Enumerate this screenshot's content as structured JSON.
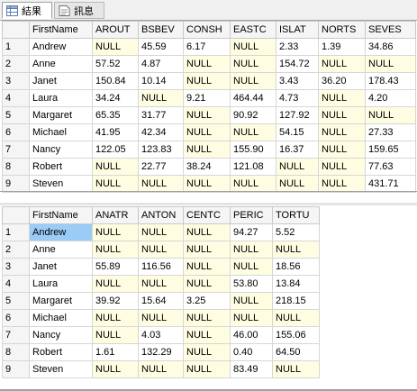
{
  "tabs": [
    {
      "label": "結果",
      "icon": "grid-icon"
    },
    {
      "label": "訊息",
      "icon": "message-icon"
    }
  ],
  "colors": {
    "null_cell": "#fffde1",
    "selected_cell": "#9bcbf7",
    "header": "#f5f5f5"
  },
  "grid1": {
    "columns": [
      "",
      "FirstName",
      "AROUT",
      "BSBEV",
      "CONSH",
      "EASTC",
      "ISLAT",
      "NORTS",
      "SEVES"
    ],
    "rows": [
      [
        "1",
        "Andrew",
        "NULL",
        "45.59",
        "6.17",
        "NULL",
        "2.33",
        "1.39",
        "34.86"
      ],
      [
        "2",
        "Anne",
        "57.52",
        "4.87",
        "NULL",
        "NULL",
        "154.72",
        "NULL",
        "NULL"
      ],
      [
        "3",
        "Janet",
        "150.84",
        "10.14",
        "NULL",
        "NULL",
        "3.43",
        "36.20",
        "178.43"
      ],
      [
        "4",
        "Laura",
        "34.24",
        "NULL",
        "9.21",
        "464.44",
        "4.73",
        "NULL",
        "4.20"
      ],
      [
        "5",
        "Margaret",
        "65.35",
        "31.77",
        "NULL",
        "90.92",
        "127.92",
        "NULL",
        "NULL"
      ],
      [
        "6",
        "Michael",
        "41.95",
        "42.34",
        "NULL",
        "NULL",
        "54.15",
        "NULL",
        "27.33"
      ],
      [
        "7",
        "Nancy",
        "122.05",
        "123.83",
        "NULL",
        "155.90",
        "16.37",
        "NULL",
        "159.65"
      ],
      [
        "8",
        "Robert",
        "NULL",
        "22.77",
        "38.24",
        "121.08",
        "NULL",
        "NULL",
        "77.63"
      ],
      [
        "9",
        "Steven",
        "NULL",
        "NULL",
        "NULL",
        "NULL",
        "NULL",
        "NULL",
        "431.71"
      ]
    ]
  },
  "grid2": {
    "columns": [
      "",
      "FirstName",
      "ANATR",
      "ANTON",
      "CENTC",
      "PERIC",
      "TORTU"
    ],
    "rows": [
      [
        "1",
        "Andrew",
        "NULL",
        "NULL",
        "NULL",
        "94.27",
        "5.52"
      ],
      [
        "2",
        "Anne",
        "NULL",
        "NULL",
        "NULL",
        "NULL",
        "NULL"
      ],
      [
        "3",
        "Janet",
        "55.89",
        "116.56",
        "NULL",
        "NULL",
        "18.56"
      ],
      [
        "4",
        "Laura",
        "NULL",
        "NULL",
        "NULL",
        "53.80",
        "13.84"
      ],
      [
        "5",
        "Margaret",
        "39.92",
        "15.64",
        "3.25",
        "NULL",
        "218.15"
      ],
      [
        "6",
        "Michael",
        "NULL",
        "NULL",
        "NULL",
        "NULL",
        "NULL"
      ],
      [
        "7",
        "Nancy",
        "NULL",
        "4.03",
        "NULL",
        "46.00",
        "155.06"
      ],
      [
        "8",
        "Robert",
        "1.61",
        "132.29",
        "NULL",
        "0.40",
        "64.50"
      ],
      [
        "9",
        "Steven",
        "NULL",
        "NULL",
        "NULL",
        "83.49",
        "NULL"
      ]
    ]
  }
}
